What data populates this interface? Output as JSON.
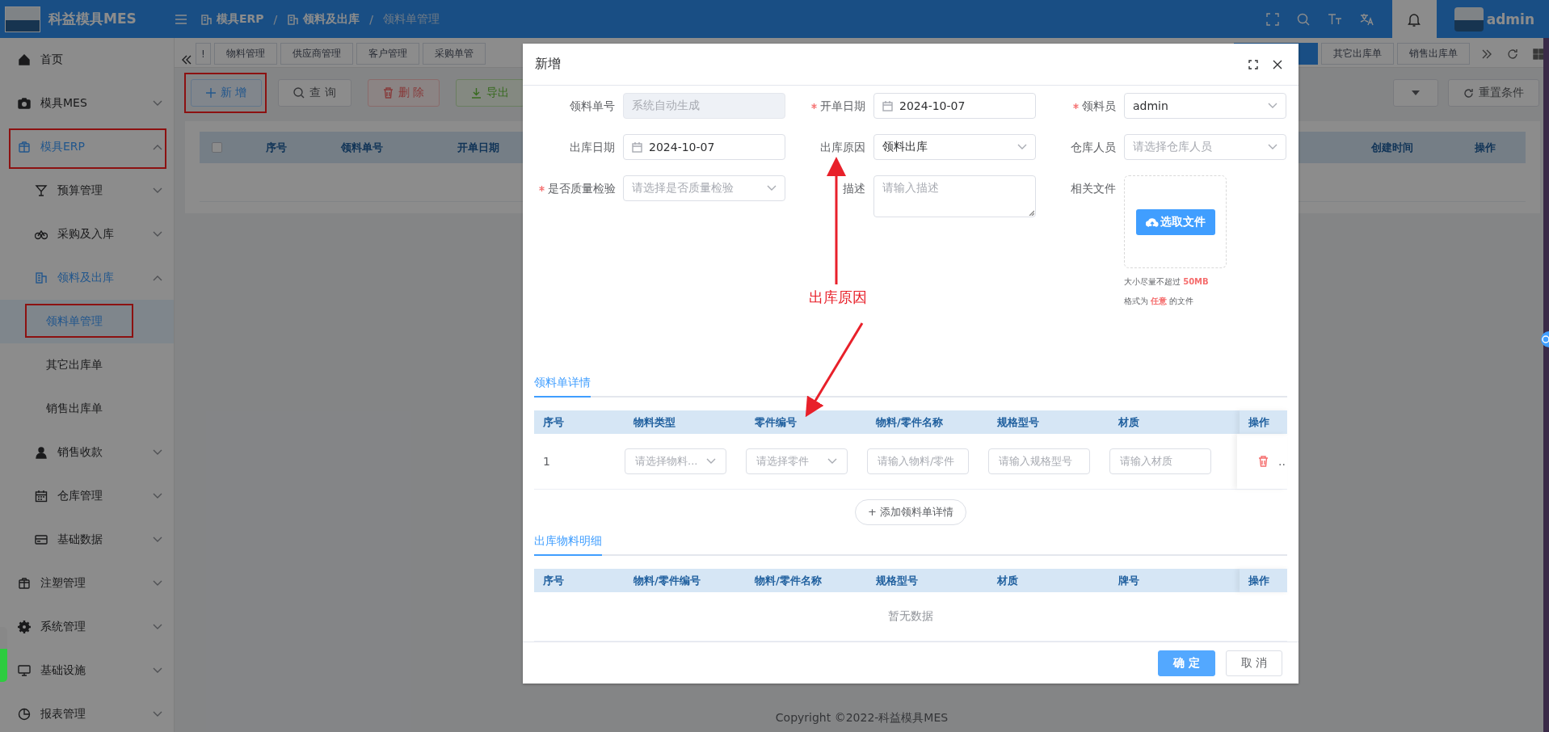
{
  "header": {
    "app_title": "科益模具MES",
    "separator": "/",
    "breadcrumb": [
      {
        "label": "模具ERP"
      },
      {
        "label": "领料及出库"
      },
      {
        "label": "领料单管理"
      }
    ],
    "user": "admin"
  },
  "sidebar": {
    "items": [
      {
        "label": "首页",
        "selected": false,
        "boxed": false
      },
      {
        "label": "模具MES",
        "expanded": false,
        "selected": false,
        "boxed": false
      },
      {
        "label": "模具ERP",
        "expanded": true,
        "selected": false,
        "boxed": true,
        "children": [
          {
            "label": "预算管理",
            "expanded": false,
            "selected": false,
            "boxed": false
          },
          {
            "label": "采购及入库",
            "expanded": false,
            "selected": false,
            "boxed": false
          },
          {
            "label": "领料及出库",
            "expanded": true,
            "selected": false,
            "boxed": false,
            "children": [
              {
                "label": "领料单管理",
                "selected": true,
                "boxed": true
              },
              {
                "label": "其它出库单",
                "selected": false,
                "boxed": false
              },
              {
                "label": "销售出库单",
                "selected": false,
                "boxed": false
              }
            ]
          },
          {
            "label": "销售收款",
            "expanded": false,
            "selected": false,
            "boxed": false
          },
          {
            "label": "仓库管理",
            "expanded": false,
            "selected": false,
            "boxed": false
          },
          {
            "label": "基础数据",
            "expanded": false,
            "selected": false,
            "boxed": false
          }
        ]
      },
      {
        "label": "注塑管理",
        "expanded": false,
        "selected": false,
        "boxed": false
      },
      {
        "label": "系统管理",
        "expanded": false,
        "selected": false,
        "boxed": false
      },
      {
        "label": "基础设施",
        "expanded": false,
        "selected": false,
        "boxed": false
      },
      {
        "label": "报表管理",
        "expanded": false,
        "selected": false,
        "boxed": false
      }
    ]
  },
  "tabs": [
    {
      "label": "!",
      "selected": false
    },
    {
      "label": "物料管理",
      "selected": false
    },
    {
      "label": "供应商管理",
      "selected": false
    },
    {
      "label": "客户管理",
      "selected": false
    },
    {
      "label": "采购单管",
      "selected": false
    },
    {
      "selected": true
    },
    {
      "label": "其它出库单",
      "selected": false
    },
    {
      "label": "销售出库单",
      "selected": false
    }
  ],
  "toolbar": {
    "buttons": [
      {
        "label": "新 增",
        "kind": "primary",
        "boxed": true
      },
      {
        "label": "查 询",
        "kind": "default",
        "boxed": false
      },
      {
        "label": "删 除",
        "kind": "danger",
        "boxed": false
      },
      {
        "label": "导出",
        "kind": "success",
        "boxed": false
      }
    ],
    "reset_button": "重置条件"
  },
  "table": {
    "select_all_checked": false,
    "columns": [
      "序号",
      "领料单号",
      "开单日期",
      "创建时间",
      "操作"
    ]
  },
  "footer": "Copyright ©2022-科益模具MES",
  "dialog": {
    "title": "新增",
    "fields": [
      {
        "label": "领料单号",
        "kind": "text",
        "required": false,
        "disabled": true,
        "placeholder": "系统自动生成"
      },
      {
        "label": "开单日期",
        "kind": "date",
        "required": true,
        "disabled": false,
        "value": "2024-10-07"
      },
      {
        "label": "领料员",
        "kind": "select",
        "required": true,
        "disabled": false,
        "value": "admin"
      },
      {
        "label": "出库日期",
        "kind": "date",
        "required": false,
        "disabled": false,
        "value": "2024-10-07"
      },
      {
        "label": "出库原因",
        "kind": "select",
        "required": false,
        "disabled": false,
        "value": "领料出库"
      },
      {
        "label": "仓库人员",
        "kind": "select",
        "required": false,
        "disabled": false,
        "placeholder": "请选择仓库人员"
      },
      {
        "label": "是否质量检验",
        "kind": "select",
        "required": true,
        "disabled": false,
        "placeholder": "请选择是否质量检验"
      },
      {
        "label": "描述",
        "kind": "textarea",
        "required": false,
        "disabled": false,
        "placeholder": "请输入描述"
      },
      {
        "label": "相关文件",
        "kind": "upload",
        "required": false,
        "disabled": false,
        "button": "选取文件",
        "hints": [
          "大小尽量不超过 **50MB**",
          "格式为 **任意** 的文件"
        ]
      }
    ],
    "annotation": "出库原因",
    "detail": {
      "tab": "领料单详情",
      "columns": [
        "序号",
        "物料类型",
        "零件编号",
        "物料/零件名称",
        "规格型号",
        "材质"
      ],
      "action_column": "操作",
      "rows": [
        {
          "cells": [
            {
              "kind": "text",
              "text": "1"
            },
            {
              "kind": "select",
              "placeholder": "请选择物料..."
            },
            {
              "kind": "select",
              "placeholder": "请选择零件"
            },
            {
              "kind": "input",
              "placeholder": "请输入物料/零件"
            },
            {
              "kind": "input",
              "placeholder": "请输入规格型号"
            },
            {
              "kind": "input",
              "placeholder": "请输入材质"
            }
          ],
          "more": ".."
        }
      ],
      "add_button": "+ 添加领料单详情"
    },
    "outbound": {
      "tab": "出库物料明细",
      "columns": [
        "序号",
        "物料/零件编号",
        "物料/零件名称",
        "规格型号",
        "材质",
        "牌号"
      ],
      "action_column": "操作",
      "empty_text": "暂无数据"
    },
    "buttons": [
      {
        "label": "确 定",
        "kind": "primary"
      },
      {
        "label": "取 消",
        "kind": "default"
      }
    ]
  }
}
